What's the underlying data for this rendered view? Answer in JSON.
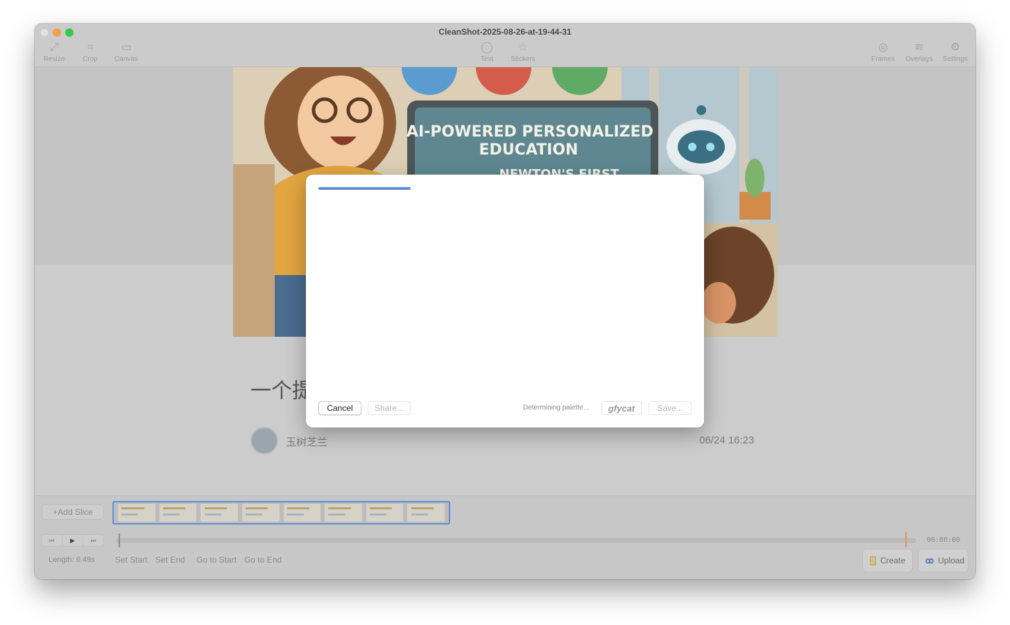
{
  "window": {
    "title": "CleanShot-2025-08-26-at-19-44-31",
    "traffic_colors": {
      "close": "#e3e3e3",
      "minimize": "#f0a04b",
      "maximize": "#35c84a"
    }
  },
  "toolbar": {
    "left": [
      {
        "label": "Resize",
        "icon": "resize-icon",
        "glyph": "⤢"
      },
      {
        "label": "Crop",
        "icon": "crop-icon",
        "glyph": "⌗"
      },
      {
        "label": "Canvas",
        "icon": "canvas-icon",
        "glyph": "▭"
      }
    ],
    "center": [
      {
        "label": "Text",
        "icon": "speech-bubble-icon",
        "glyph": "💬"
      },
      {
        "label": "Stickers",
        "icon": "star-icon",
        "glyph": "☆"
      }
    ],
    "right": [
      {
        "label": "Frames",
        "icon": "frames-icon",
        "glyph": "◎"
      },
      {
        "label": "Overlays",
        "icon": "layers-icon",
        "glyph": "≋"
      },
      {
        "label": "Settings",
        "icon": "gear-icon",
        "glyph": "⚙"
      }
    ]
  },
  "content": {
    "image_text": {
      "line1": "AI-POWERED PERSONALIZED",
      "line2": "EDUCATION",
      "line3": "NEWTON'S FIRST"
    },
    "heading": "一个提",
    "author": "玉树芝兰",
    "time": "06/24 16:23"
  },
  "timeline": {
    "add_slice": "+Add Slice",
    "length": "Length: 6.49s",
    "timecode": "00:00:00",
    "set_start": "Set Start",
    "set_end": "Set End",
    "go_to_start": "Go to Start",
    "go_to_end": "Go to End",
    "create": "Create",
    "upload": "Upload",
    "thumbnail_count": 8
  },
  "modal": {
    "progress": 0.23,
    "cancel": "Cancel",
    "share": "Share...",
    "status": "Determining palette...",
    "gfycat": "gfycat",
    "save": "Save...",
    "accent": "#5b8fdb"
  }
}
